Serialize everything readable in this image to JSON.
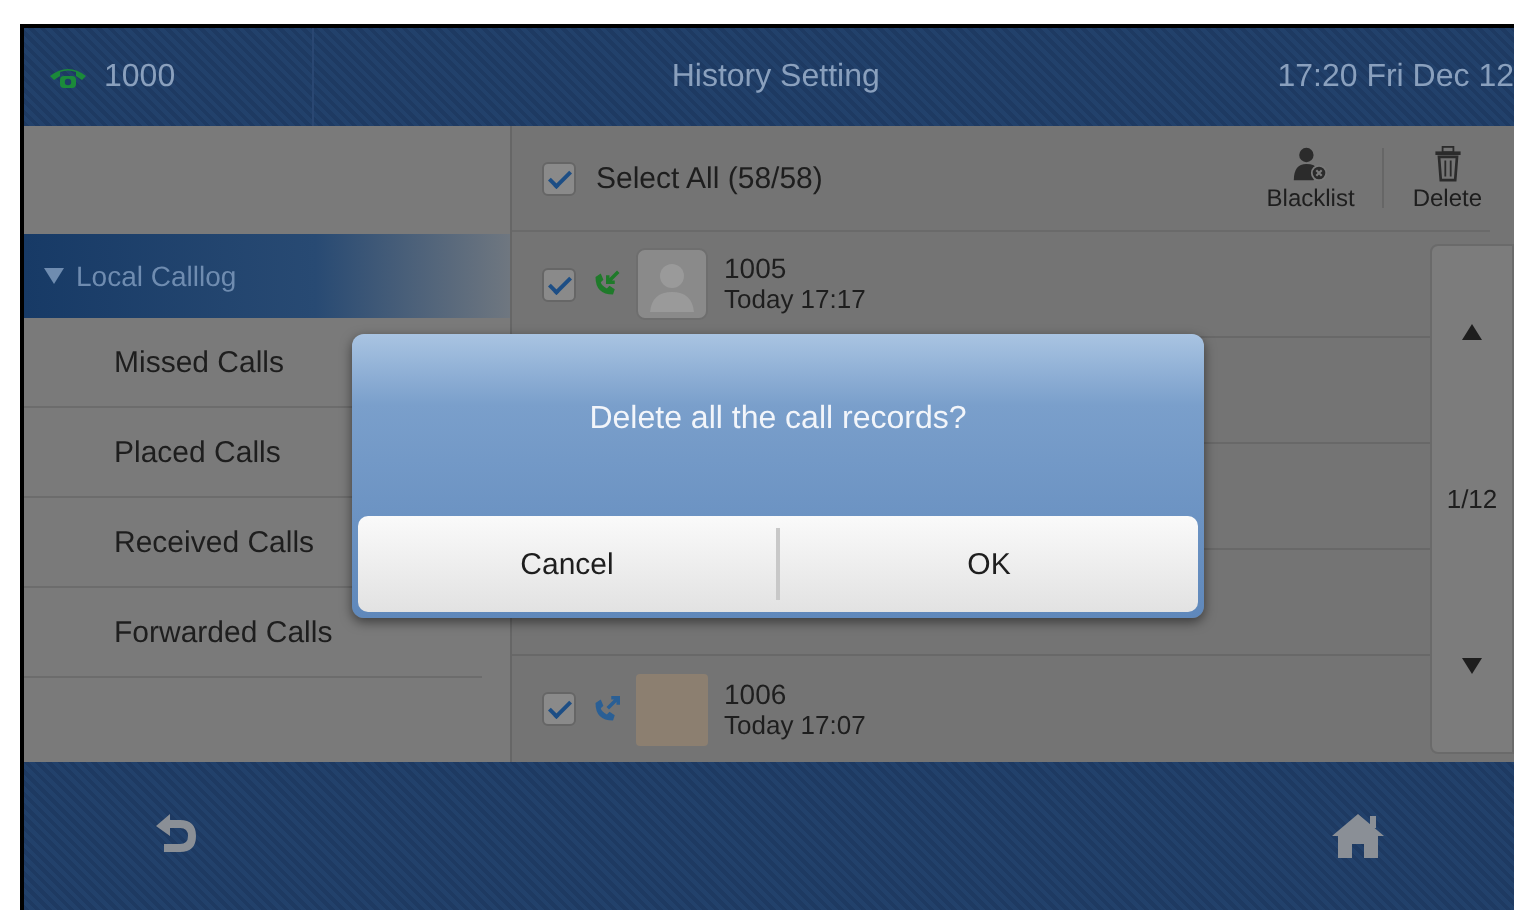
{
  "status_bar": {
    "line": "1000",
    "title": "History Setting",
    "clock": "17:20 Fri Dec 12"
  },
  "sidebar": {
    "group": {
      "label": "Local Calllog",
      "expanded": true,
      "selected": true
    },
    "items": [
      {
        "label": "Missed Calls",
        "selected": false
      },
      {
        "label": "Placed Calls",
        "selected": false
      },
      {
        "label": "Received Calls",
        "selected": false
      },
      {
        "label": "Forwarded Calls",
        "selected": false
      }
    ]
  },
  "toolbar": {
    "select_all": {
      "label": "Select All (58/58)",
      "checked": true
    },
    "actions": [
      {
        "label": "Blacklist",
        "kind": "blacklist"
      },
      {
        "label": "Delete",
        "kind": "delete"
      }
    ]
  },
  "calls": [
    {
      "number": "1005",
      "time": "Today 17:17",
      "checked": true,
      "kind": "received",
      "photo": false
    },
    {
      "number": "1006",
      "time": "Today 17:07",
      "checked": true,
      "kind": "placed",
      "photo": true
    }
  ],
  "pager": {
    "page": "1/12"
  },
  "dialog": {
    "message": "Delete all the call records?",
    "buttons": [
      "Cancel",
      "OK"
    ]
  },
  "softkeys": [
    {
      "kind": "back"
    },
    {
      "kind": "home"
    }
  ]
}
